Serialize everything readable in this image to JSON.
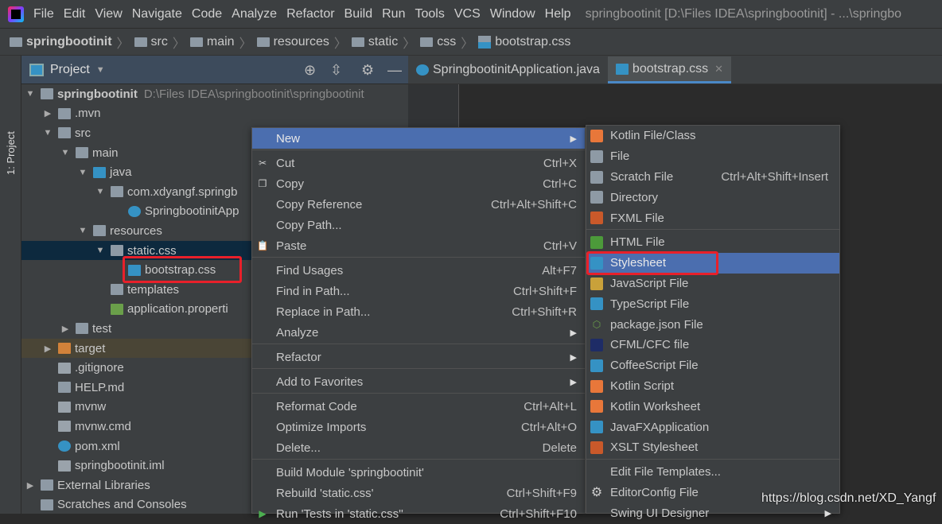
{
  "menubar": {
    "items": [
      "File",
      "Edit",
      "View",
      "Navigate",
      "Code",
      "Analyze",
      "Refactor",
      "Build",
      "Run",
      "Tools",
      "VCS",
      "Window",
      "Help"
    ],
    "title": "springbootinit [D:\\Files IDEA\\springbootinit] - ...\\springbo"
  },
  "breadcrumb": [
    "springbootinit",
    "src",
    "main",
    "resources",
    "static",
    "css",
    "bootstrap.css"
  ],
  "sidestrip": {
    "label": "1: Project"
  },
  "panel": {
    "title": "Project"
  },
  "tree": [
    {
      "level": 0,
      "arrow": "open",
      "icon": "module",
      "label": "springbootinit",
      "bold": true,
      "path": "D:\\Files IDEA\\springbootinit\\springbootinit"
    },
    {
      "level": 1,
      "arrow": "closed",
      "icon": "folder",
      "label": ".mvn"
    },
    {
      "level": 1,
      "arrow": "open",
      "icon": "folder",
      "label": "src"
    },
    {
      "level": 2,
      "arrow": "open",
      "icon": "folder",
      "label": "main"
    },
    {
      "level": 3,
      "arrow": "open",
      "icon": "folder-blue",
      "label": "java"
    },
    {
      "level": 4,
      "arrow": "open",
      "icon": "package",
      "label": "com.xdyangf.springb"
    },
    {
      "level": 5,
      "arrow": "none",
      "icon": "spring-class",
      "label": "SpringbootinitApp"
    },
    {
      "level": 3,
      "arrow": "open",
      "icon": "resources",
      "label": "resources"
    },
    {
      "level": 4,
      "arrow": "open",
      "icon": "folder",
      "label": "static.css",
      "selected": true
    },
    {
      "level": 5,
      "arrow": "none",
      "icon": "css",
      "label": "bootstrap.css",
      "boxed": true
    },
    {
      "level": 4,
      "arrow": "none",
      "icon": "folder",
      "label": "templates"
    },
    {
      "level": 4,
      "arrow": "none",
      "icon": "properties",
      "label": "application.properti"
    },
    {
      "level": 2,
      "arrow": "closed",
      "icon": "folder",
      "label": "test"
    },
    {
      "level": 1,
      "arrow": "closed",
      "icon": "folder-orange",
      "label": "target",
      "target": true
    },
    {
      "level": 1,
      "arrow": "none",
      "icon": "file",
      "label": ".gitignore"
    },
    {
      "level": 1,
      "arrow": "none",
      "icon": "markdown",
      "label": "HELP.md"
    },
    {
      "level": 1,
      "arrow": "none",
      "icon": "file",
      "label": "mvnw"
    },
    {
      "level": 1,
      "arrow": "none",
      "icon": "file",
      "label": "mvnw.cmd"
    },
    {
      "level": 1,
      "arrow": "none",
      "icon": "maven",
      "label": "pom.xml"
    },
    {
      "level": 1,
      "arrow": "none",
      "icon": "file",
      "label": "springbootinit.iml"
    },
    {
      "level": 0,
      "arrow": "closed",
      "icon": "libraries",
      "label": "External Libraries"
    },
    {
      "level": 0,
      "arrow": "none",
      "icon": "scratches",
      "label": "Scratches and Consoles"
    }
  ],
  "tabs": [
    {
      "label": "SpringbootinitApplication.java",
      "active": false
    },
    {
      "label": "bootstrap.css",
      "active": true
    }
  ],
  "context_menu": [
    {
      "label": "New",
      "submenu": true,
      "highlighted": true
    },
    {
      "sep": true
    },
    {
      "label": "Cut",
      "shortcut": "Ctrl+X",
      "icon": "scissors-icon"
    },
    {
      "label": "Copy",
      "shortcut": "Ctrl+C",
      "icon": "copy-icon"
    },
    {
      "label": "Copy Reference",
      "shortcut": "Ctrl+Alt+Shift+C"
    },
    {
      "label": "Copy Path...",
      "shortcut": ""
    },
    {
      "label": "Paste",
      "shortcut": "Ctrl+V",
      "icon": "clipboard-icon"
    },
    {
      "sep": true
    },
    {
      "label": "Find Usages",
      "shortcut": "Alt+F7"
    },
    {
      "label": "Find in Path...",
      "shortcut": "Ctrl+Shift+F"
    },
    {
      "label": "Replace in Path...",
      "shortcut": "Ctrl+Shift+R"
    },
    {
      "label": "Analyze",
      "submenu": true
    },
    {
      "sep": true
    },
    {
      "label": "Refactor",
      "submenu": true
    },
    {
      "sep": true
    },
    {
      "label": "Add to Favorites",
      "submenu": true
    },
    {
      "sep": true
    },
    {
      "label": "Reformat Code",
      "shortcut": "Ctrl+Alt+L"
    },
    {
      "label": "Optimize Imports",
      "shortcut": "Ctrl+Alt+O"
    },
    {
      "label": "Delete...",
      "shortcut": "Delete"
    },
    {
      "sep": true
    },
    {
      "label": "Build Module 'springbootinit'",
      "shortcut": ""
    },
    {
      "label": "Rebuild 'static.css'",
      "shortcut": "Ctrl+Shift+F9"
    },
    {
      "label": "Run 'Tests in 'static.css''",
      "shortcut": "Ctrl+Shift+F10",
      "icon": "run-icon"
    }
  ],
  "new_submenu": [
    {
      "label": "Kotlin File/Class",
      "icon": "kotlin"
    },
    {
      "label": "File",
      "icon": "file"
    },
    {
      "label": "Scratch File",
      "shortcut": "Ctrl+Alt+Shift+Insert",
      "icon": "scratch"
    },
    {
      "label": "Directory",
      "icon": "folder"
    },
    {
      "label": "FXML File",
      "icon": "fxml"
    },
    {
      "sep": true
    },
    {
      "label": "HTML File",
      "icon": "html"
    },
    {
      "label": "Stylesheet",
      "icon": "css",
      "highlighted": true,
      "boxed": true
    },
    {
      "label": "JavaScript File",
      "icon": "js"
    },
    {
      "label": "TypeScript File",
      "icon": "ts"
    },
    {
      "label": "package.json File",
      "icon": "nodejs"
    },
    {
      "label": "CFML/CFC file",
      "icon": "cfml"
    },
    {
      "label": "CoffeeScript File",
      "icon": "coffee"
    },
    {
      "label": "Kotlin Script",
      "icon": "kotlin"
    },
    {
      "label": "Kotlin Worksheet",
      "icon": "kotlin"
    },
    {
      "label": "JavaFXApplication",
      "icon": "javafx"
    },
    {
      "label": "XSLT Stylesheet",
      "icon": "xslt"
    },
    {
      "sep": true
    },
    {
      "label": "Edit File Templates..."
    },
    {
      "label": "EditorConfig File",
      "icon": "gear"
    },
    {
      "label": "Swing UI Designer",
      "submenu": true
    }
  ],
  "colors": {
    "highlight": "#4b6eaf",
    "annotation_box": "#e8202a",
    "menu_bg": "#3c3f41"
  },
  "watermark": "https://blog.csdn.net/XD_Yangf"
}
